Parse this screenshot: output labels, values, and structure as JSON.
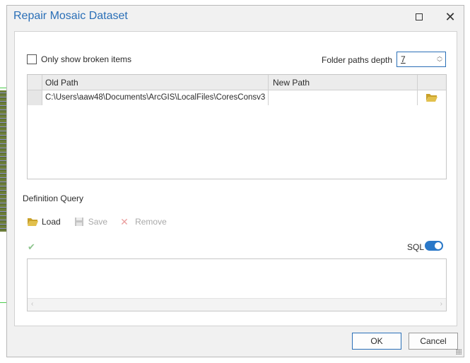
{
  "dialog": {
    "title": "Repair Mosaic Dataset"
  },
  "options": {
    "only_broken_label": "Only show broken items",
    "folder_depth_label": "Folder paths depth",
    "folder_depth_value": "7"
  },
  "grid": {
    "columns": [
      "Old Path",
      "New Path"
    ],
    "rows": [
      {
        "old_path": "C:\\Users\\aaw48\\Documents\\ArcGIS\\LocalFiles\\CoresConsv3",
        "new_path": ""
      }
    ]
  },
  "definition_query": {
    "label": "Definition Query",
    "load_label": "Load",
    "save_label": "Save",
    "remove_label": "Remove",
    "sql_label": "SQL",
    "sql_enabled": true
  },
  "footer": {
    "ok_label": "OK",
    "cancel_label": "Cancel"
  },
  "colors": {
    "title": "#2a6fb7",
    "accent": "#2a78c8",
    "folder": "#d9b43a"
  }
}
